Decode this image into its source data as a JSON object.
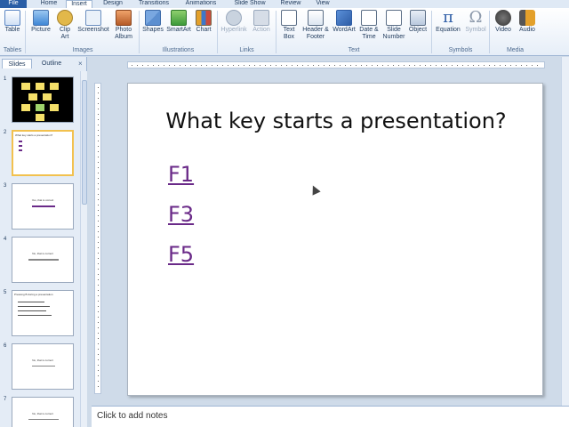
{
  "ribbon_tabs": [
    "File",
    "Home",
    "Insert",
    "Design",
    "Transitions",
    "Animations",
    "Slide Show",
    "Review",
    "View"
  ],
  "ribbon_buttons": {
    "table": "Table",
    "picture": "Picture",
    "clip_art": "Clip Art",
    "screenshot": "Screenshot",
    "photo_album": "Photo Album",
    "shapes": "Shapes",
    "smartart": "SmartArt",
    "chart": "Chart",
    "hyperlink": "Hyperlink",
    "action": "Action",
    "text_box": "Text Box",
    "header_footer": "Header & Footer",
    "wordart": "WordArt",
    "date_time": "Date & Time",
    "slide_number": "Slide Number",
    "object": "Object",
    "equation": "Equation",
    "symbol": "Symbol",
    "video": "Video",
    "audio": "Audio"
  },
  "ribbon_groups": [
    "Tables",
    "Images",
    "Illustrations",
    "Links",
    "Text",
    "Symbols",
    "Media"
  ],
  "panel": {
    "tab_slides": "Slides",
    "tab_outline": "Outline",
    "close": "×"
  },
  "thumbnails": [
    {
      "num": "1"
    },
    {
      "num": "2",
      "text": "What key starts a presentation?"
    },
    {
      "num": "3",
      "text": "Yes, that is correct"
    },
    {
      "num": "4",
      "text": "No, that is correct"
    },
    {
      "num": "5",
      "text": "Pressing B during a presentation"
    },
    {
      "num": "6",
      "text": "No, that is correct"
    },
    {
      "num": "7",
      "text": "No, that is correct"
    }
  ],
  "slide": {
    "title": "What key starts a presentation?",
    "options": [
      "F1",
      "F3",
      "F5"
    ]
  },
  "notes": {
    "placeholder": "Click to add notes"
  },
  "colors": {
    "file_tab": "#2a5ea6",
    "link": "#6a2a88",
    "selected_thumb": "#f2c14e",
    "thumb1_bg": "#000000",
    "thumb1_notes": "#f5e06a"
  }
}
